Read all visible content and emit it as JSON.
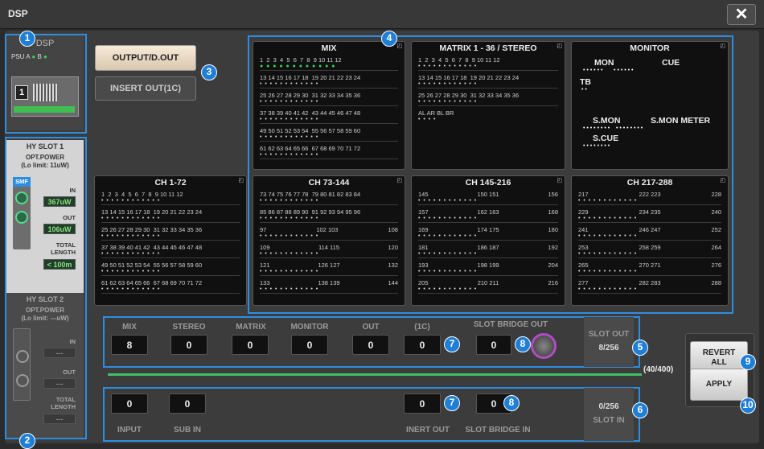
{
  "window": {
    "title": "DSP",
    "close_label": "✕"
  },
  "dsp": {
    "label": "DSP",
    "psu": "PSU A",
    "psu_b": "B",
    "unit_number": "1"
  },
  "slot1": {
    "title": "HY SLOT 1",
    "opt_power": "OPT.POWER",
    "limit": "(Lo limit: 11uW)",
    "sfp_label": "SMF",
    "in_label": "IN",
    "in_value": "367uW",
    "out_label": "OUT",
    "out_value": "106uW",
    "total_label": "TOTAL\nLENGTH",
    "total_value": "< 100m"
  },
  "slot2": {
    "title": "HY SLOT 2",
    "opt_power": "OPT.POWER",
    "limit": "(Lo limit: ---uW)",
    "in_label": "IN",
    "in_value": "---",
    "out_label": "OUT",
    "out_value": "---",
    "total_label": "TOTAL\nLENGTH",
    "total_value": "---"
  },
  "buttons": {
    "output": "OUTPUT/D.OUT",
    "insert": "INSERT OUT(1C)",
    "revert": "REVERT\nALL",
    "apply": "APPLY"
  },
  "blocks": {
    "mix": {
      "title": "MIX",
      "rows": [
        "1  2  3  4  5  6  7  8  9 10 11 12",
        "13 14 15 16 17 18  19 20 21 22 23 24",
        "25 26 27 28 29 30  31 32 33 34 35 36",
        "37 38 39 40 41 42  43 44 45 46 47 48",
        "49 50 51 52 53 54  55 56 57 58 59 60",
        "61 62 63 64 65 66  67 68 69 70 71 72"
      ]
    },
    "matrix": {
      "title": "MATRIX 1 - 36 / STEREO",
      "rows": [
        "1  2  3  4  5  6  7  8  9 10 11 12",
        "13 14 15 16 17 18  19 20 21 22 23 24",
        "25 26 27 28 29 30  31 32 33 34 35 36",
        "AL AR BL BR"
      ]
    },
    "monitor": {
      "title": "MONITOR",
      "mon": "MON",
      "cue": "CUE",
      "tb": "TB",
      "smon": "S.MON",
      "smon_meter": "S.MON METER",
      "scue": "S.CUE"
    },
    "ch1": {
      "title": "CH 1-72",
      "rows": [
        "1  2  3  4  5  6  7  8  9 10 11 12",
        "13 14 15 16 17 18  19 20 21 22 23 24",
        "25 26 27 28 29 30  31 32 33 34 35 36",
        "37 38 39 40 41 42  43 44 45 46 47 48",
        "49 50 51 52 53 54  55 56 57 58 59 60",
        "61 62 63 64 65 66  67 68 69 70 71 72"
      ]
    },
    "ch73": {
      "title": "CH 73-144",
      "rows": [
        "73 74 75 76 77 78  79 80 81 82 83 84",
        "85 86 87 88 89 90  91 92 93 94 95 96"
      ],
      "ranges": [
        [
          "97",
          "102 103",
          "108"
        ],
        [
          "109",
          "114 115",
          "120"
        ],
        [
          "121",
          "126 127",
          "132"
        ],
        [
          "133",
          "138 139",
          "144"
        ]
      ]
    },
    "ch145": {
      "title": "CH 145-216",
      "ranges": [
        [
          "145",
          "150 151",
          "156"
        ],
        [
          "157",
          "162 163",
          "168"
        ],
        [
          "169",
          "174 175",
          "180"
        ],
        [
          "181",
          "186 187",
          "192"
        ],
        [
          "193",
          "198 199",
          "204"
        ],
        [
          "205",
          "210 211",
          "216"
        ]
      ]
    },
    "ch217": {
      "title": "CH 217-288",
      "ranges": [
        [
          "217",
          "222 223",
          "228"
        ],
        [
          "229",
          "234 235",
          "240"
        ],
        [
          "241",
          "246 247",
          "252"
        ],
        [
          "253",
          "258 259",
          "264"
        ],
        [
          "265",
          "270 271",
          "276"
        ],
        [
          "277",
          "282 283",
          "288"
        ]
      ]
    }
  },
  "out_bus": {
    "labels": [
      "MIX",
      "STEREO",
      "MATRIX",
      "MONITOR",
      "OUT",
      "(1C)"
    ],
    "values": [
      "8",
      "0",
      "0",
      "0",
      "0",
      "0"
    ],
    "slot_bridge_out_label": "SLOT BRIDGE OUT",
    "slot_bridge_out_value": "0",
    "slot_out_label": "SLOT OUT",
    "slot_out_value": "8/256"
  },
  "total": "(40/400)",
  "in_bus": {
    "input_label": "INPUT",
    "input_value": "0",
    "subin_label": "SUB IN",
    "subin_value": "0",
    "inert_out_label": "INERT OUT",
    "inert_out_value": "0",
    "slot_bridge_in_label": "SLOT BRIDGE IN",
    "slot_bridge_in_value": "0",
    "slot_in_label": "SLOT IN",
    "slot_in_value": "0/256"
  },
  "badges": [
    "1",
    "2",
    "3",
    "4",
    "5",
    "6",
    "7",
    "8",
    "9",
    "10"
  ],
  "colors": {
    "accent": "#1f7fd6",
    "meter_green": "#38d15a",
    "knob_ring": "#b04cc6"
  }
}
